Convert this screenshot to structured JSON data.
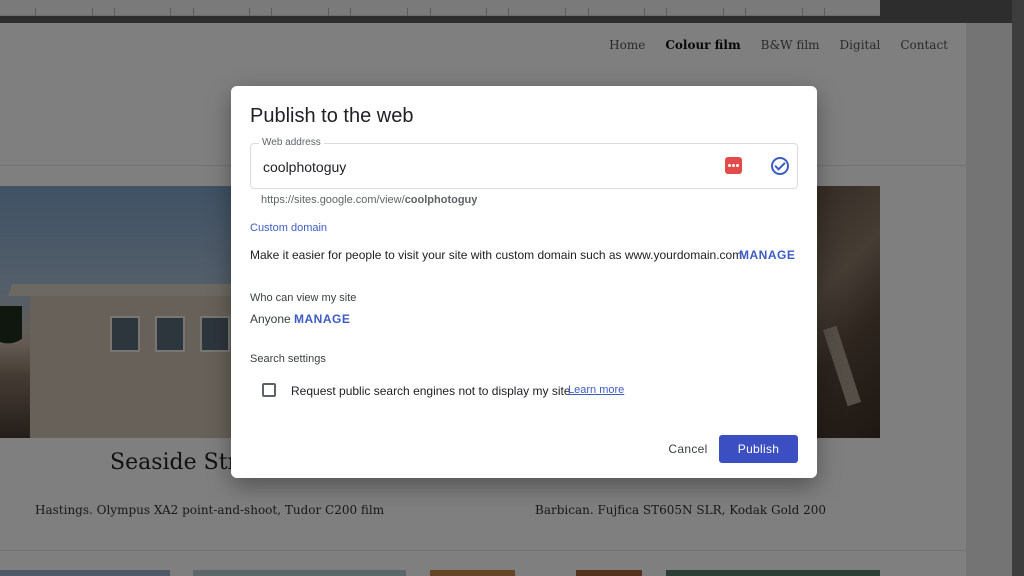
{
  "site": {
    "nav": [
      "Home",
      "Colour film",
      "B&W film",
      "Digital",
      "Contact"
    ],
    "active_nav": "Colour film",
    "caption_title": "Seaside Stree",
    "caption_left": "Hastings. Olympus XA2 point-and-shoot, Tudor C200 film",
    "caption_right": "Barbican. Fujfica ST605N SLR, Kodak Gold 200"
  },
  "dialog": {
    "title": "Publish to the web",
    "web_address": {
      "label": "Web address",
      "value": "coolphotoguy",
      "url_prefix": "https://sites.google.com/view/",
      "url_suffix": "coolphotoguy"
    },
    "custom_domain": {
      "heading": "Custom domain",
      "description": "Make it easier for people to visit your site with custom domain such as www.yourdomain.com",
      "manage_label": "MANAGE"
    },
    "who_can_view": {
      "heading": "Who can view my site",
      "value": "Anyone",
      "manage_label": "MANAGE"
    },
    "search_settings": {
      "heading": "Search settings",
      "checkbox_label": "Request public search engines not to display my site",
      "checked": false,
      "learn_more": "Learn more"
    },
    "buttons": {
      "cancel": "Cancel",
      "publish": "Publish"
    }
  },
  "colors": {
    "accent": "#3c4fc2",
    "link": "#3c5cc4",
    "overlay": "rgba(0,0,0,0.5)"
  }
}
